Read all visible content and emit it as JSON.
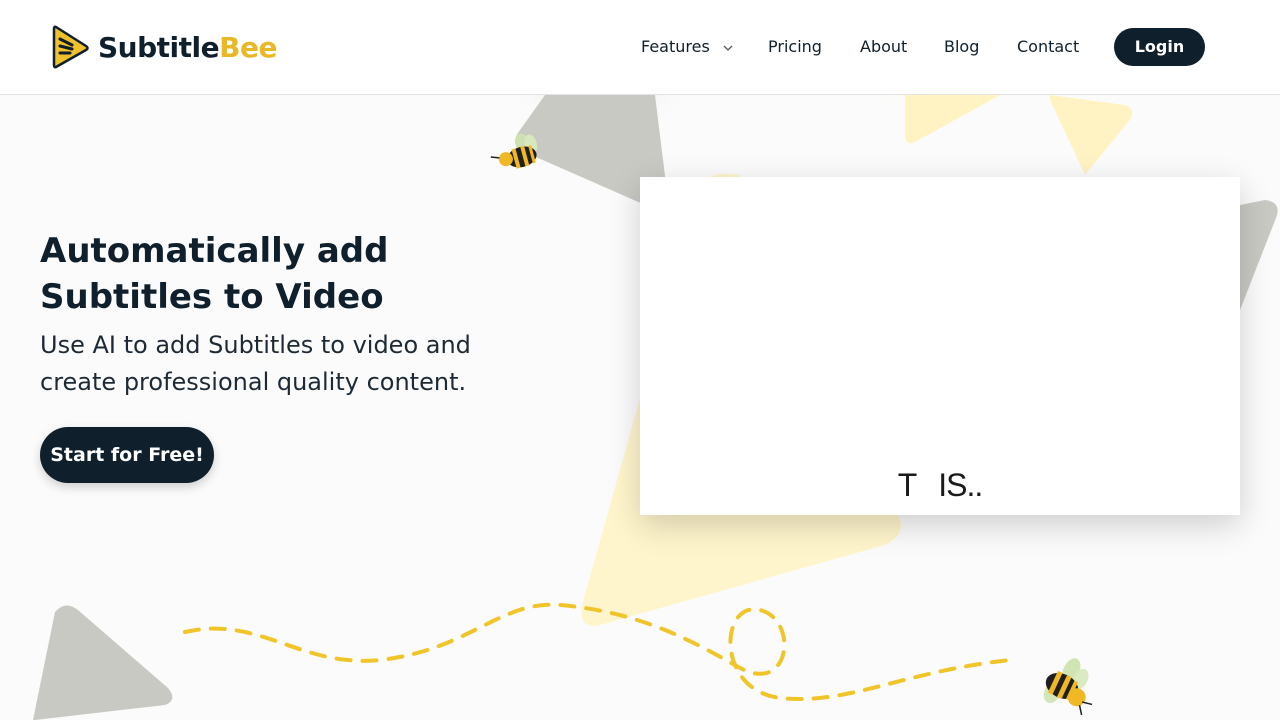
{
  "brand": {
    "name_part1": "Subtitle",
    "name_part2": "Bee",
    "colors": {
      "dark": "#0f1f2c",
      "accent": "#e8b828",
      "grey_shape": "#c9c9c4",
      "yellow_shape": "#fff3c4"
    },
    "logo_icon": "play-triangle-logo-icon"
  },
  "nav": {
    "items": [
      {
        "label": "Features",
        "has_dropdown": true
      },
      {
        "label": "Pricing"
      },
      {
        "label": "About"
      },
      {
        "label": "Blog"
      },
      {
        "label": "Contact"
      }
    ],
    "login_label": "Login"
  },
  "hero": {
    "title_line1": "Automatically add",
    "title_line2": "Subtitles to Video",
    "subtitle_line1": "Use AI to add Subtitles to video and",
    "subtitle_line2": "create professional quality content.",
    "cta_label": "Start for Free!"
  },
  "video": {
    "caption_word1": "T",
    "caption_word2": "IS.."
  },
  "icons": [
    "bee-icon",
    "chevron-down-icon",
    "play-triangle-logo-icon"
  ]
}
